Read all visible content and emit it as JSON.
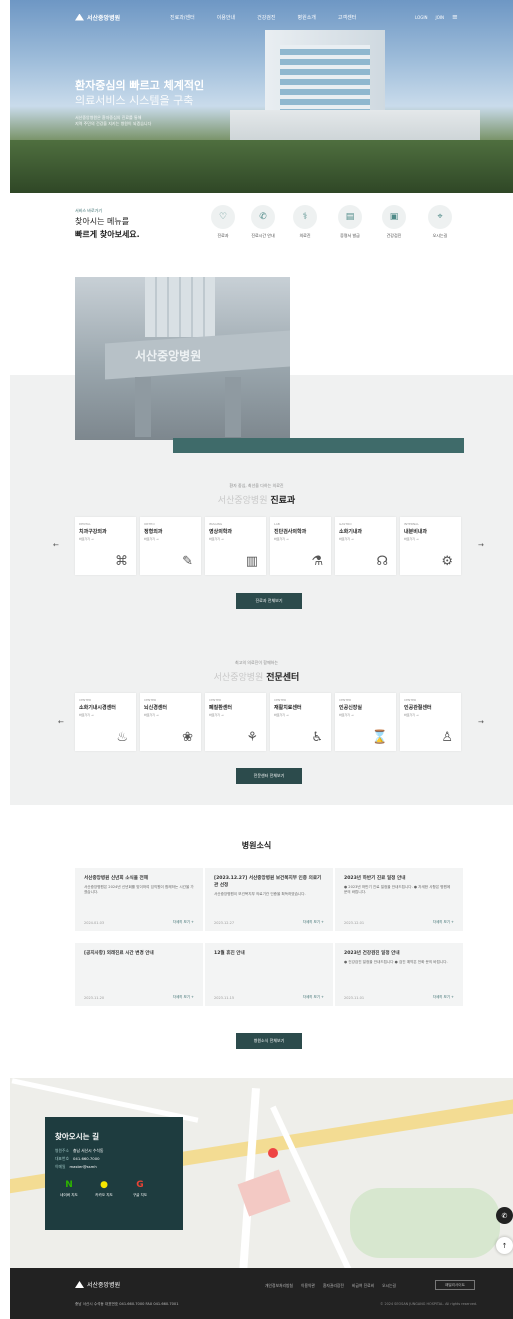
{
  "header": {
    "logo": "서산중앙병원",
    "menu": [
      "진료과/센터",
      "이용안내",
      "건강검진",
      "병원소개",
      "고객센터"
    ],
    "util": [
      "LOGIN",
      "JOIN"
    ],
    "menu_icon": "menu-icon"
  },
  "hero": {
    "title_line1": "환자중심의 빠르고 체계적인",
    "title_line2": "의료서비스 시스템을 구축",
    "sub_line1": "서산중앙병원은 환자중심의 진료를 통해",
    "sub_line2": "지역 주민의 건강을 지키는 병원이 되겠습니다"
  },
  "quick": {
    "small": "서비스 바로가기",
    "line1": "찾아시는 메뉴를",
    "line2": "빠르게 찾아보세요.",
    "items": [
      {
        "label": "진료과",
        "icon": "stethoscope-icon",
        "glyph": "♡"
      },
      {
        "label": "진료시간 안내",
        "icon": "phone-icon",
        "glyph": "✆"
      },
      {
        "label": "의료진",
        "icon": "doctor-icon",
        "glyph": "⚕"
      },
      {
        "label": "증명서 발급",
        "icon": "document-icon",
        "glyph": "▤"
      },
      {
        "label": "건강검진",
        "icon": "clipboard-icon",
        "glyph": "▣"
      },
      {
        "label": "오시는길",
        "icon": "map-pin-icon",
        "glyph": "⌖"
      }
    ]
  },
  "photo": {
    "sign_text": "서산중앙병원"
  },
  "depts": {
    "small": "환자 중심, 최선을 다하는 의료진",
    "title_pre": "서산중앙병원 ",
    "title_bold": "진료과",
    "cards": [
      {
        "en": "DENTAL",
        "ko": "치과구강외과",
        "more": "바로가기 →",
        "icon": "tooth-icon",
        "glyph": "⌘"
      },
      {
        "en": "ORTHO",
        "ko": "정형외과",
        "more": "바로가기 →",
        "icon": "syringe-icon",
        "glyph": "✎"
      },
      {
        "en": "IMAGING",
        "ko": "영상의학과",
        "more": "바로가기 →",
        "icon": "xray-icon",
        "glyph": "▥"
      },
      {
        "en": "LAB",
        "ko": "진단검사의학과",
        "more": "바로가기 →",
        "icon": "flask-icon",
        "glyph": "⚗"
      },
      {
        "en": "GASTRO",
        "ko": "소화기내과",
        "more": "바로가기 →",
        "icon": "organ-icon",
        "glyph": "☊"
      },
      {
        "en": "INTERNAL",
        "ko": "내분비내과",
        "more": "바로가기 →",
        "icon": "gland-icon",
        "glyph": "⚙"
      }
    ],
    "btn": "진료과 전체보기"
  },
  "centers": {
    "small": "최고의 의료진이 함께하는",
    "title_pre": "서산중앙병원 ",
    "title_bold": "전문센터",
    "cards": [
      {
        "en": "CENTER",
        "ko": "소화기내시경센터",
        "more": "바로가기 →",
        "icon": "stomach-icon",
        "glyph": "♨"
      },
      {
        "en": "CENTER",
        "ko": "뇌신경센터",
        "more": "바로가기 →",
        "icon": "brain-icon",
        "glyph": "❀"
      },
      {
        "en": "CENTER",
        "ko": "폐질환센터",
        "more": "바로가기 →",
        "icon": "lungs-icon",
        "glyph": "⚘"
      },
      {
        "en": "CENTER",
        "ko": "재활치료센터",
        "more": "바로가기 →",
        "icon": "rehab-icon",
        "glyph": "♿"
      },
      {
        "en": "CENTER",
        "ko": "인공신장실",
        "more": "바로가기 →",
        "icon": "kidney-icon",
        "glyph": "⌛"
      },
      {
        "en": "CENTER",
        "ko": "인공관절센터",
        "more": "바로가기 →",
        "icon": "joint-icon",
        "glyph": "♙"
      }
    ],
    "btn": "전문센터 전체보기"
  },
  "news": {
    "title": "병원소식",
    "items": [
      {
        "t": "서산중앙병원 신년회 소식을 전해",
        "b": "서산중앙병원은 2024년 신년회를 맞이하여 임직원이 함께하는 시간을 가졌습니다.",
        "d": "2024.01.03",
        "m": "자세히 보기 +"
      },
      {
        "t": "[2023.12.27] 서산중앙병원 보건복지부 인증 의료기관 선정",
        "b": "서산중앙병원이 보건복지부 의료기관 인증을 획득하였습니다.",
        "d": "2023.12.27",
        "m": "자세히 보기 +"
      },
      {
        "t": "2023년 하반기 진료 일정 안내",
        "b": "● 2023년 하반기 진료 일정을 안내드립니다. ● 자세한 사항은 병원에 문의 바랍니다.",
        "d": "2023.12.01",
        "m": "자세히 보기 +"
      },
      {
        "t": "[공지사항] 외래진료 시간 변경 안내",
        "b": "",
        "d": "2023.11.20",
        "m": "자세히 보기 +"
      },
      {
        "t": "12월 휴진 안내",
        "b": "",
        "d": "2023.11.15",
        "m": "자세히 보기 +"
      },
      {
        "t": "2023년 건강검진 일정 안내",
        "b": "● 건강검진 일정을 안내드립니다 ● 검진 예약은 전화 문의 바랍니다.",
        "d": "2023.11.01",
        "m": "자세히 보기 +"
      }
    ],
    "btn": "병원소식 전체보기"
  },
  "directions": {
    "title": "찾아오시는 길",
    "rows": [
      {
        "k": "병원주소",
        "v": "충남 서산시 수석동"
      },
      {
        "k": "대표번호",
        "v": "041.660.7000"
      },
      {
        "k": "이메일",
        "v": "master@ssmh"
      }
    ],
    "buttons": [
      {
        "ico": "N",
        "label": "네이버 지도",
        "icon": "naver-icon",
        "color": "#2db400"
      },
      {
        "ico": "●",
        "label": "카카오 지도",
        "icon": "kakao-icon",
        "color": "#f7e600"
      },
      {
        "ico": "G",
        "label": "구글 지도",
        "icon": "google-icon",
        "color": "#ea4335"
      }
    ]
  },
  "footer": {
    "logo": "서산중앙병원",
    "links": [
      "개인정보처리방침",
      "이용약관",
      "환자권리장전",
      "비급여 진료비",
      "오시는길"
    ],
    "family": "패밀리사이트",
    "addr": "충남 서산시 수석동  대표번호 041.660.7000  FAX 041.660.7001",
    "copy": "© 2024 SEOSAN JUNGANG HOSPITAL. All rights reserved."
  }
}
